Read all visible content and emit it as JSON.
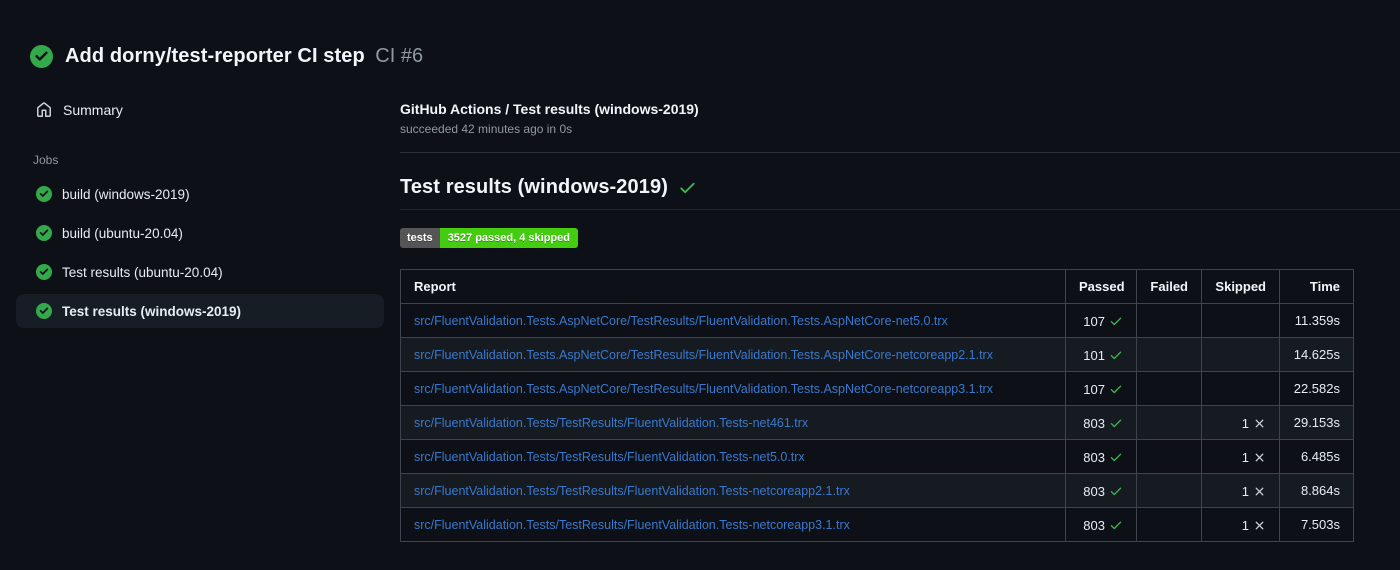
{
  "header": {
    "title": "Add dorny/test-reporter CI step",
    "run_number": "CI #6",
    "status": "success"
  },
  "sidebar": {
    "summary_label": "Summary",
    "jobs_section_label": "Jobs",
    "jobs": [
      {
        "label": "build (windows-2019)",
        "status": "success",
        "selected": false
      },
      {
        "label": "build (ubuntu-20.04)",
        "status": "success",
        "selected": false
      },
      {
        "label": "Test results (ubuntu-20.04)",
        "status": "success",
        "selected": false
      },
      {
        "label": "Test results (windows-2019)",
        "status": "success",
        "selected": true
      }
    ]
  },
  "main": {
    "check_header": {
      "title": "GitHub Actions / Test results (windows-2019)",
      "subtitle": "succeeded 42 minutes ago in 0s"
    },
    "section": {
      "title": "Test results (windows-2019)",
      "status": "success"
    },
    "badge": {
      "label": "tests",
      "value": "3527 passed, 4 skipped",
      "label_bg": "#555555",
      "value_bg": "#44cc11"
    },
    "table": {
      "headers": [
        "Report",
        "Passed",
        "Failed",
        "Skipped",
        "Time"
      ],
      "rows": [
        {
          "report": "src/FluentValidation.Tests.AspNetCore/TestResults/FluentValidation.Tests.AspNetCore-net5.0.trx",
          "passed": "107",
          "failed": "",
          "skipped": "",
          "time": "11.359s"
        },
        {
          "report": "src/FluentValidation.Tests.AspNetCore/TestResults/FluentValidation.Tests.AspNetCore-netcoreapp2.1.trx",
          "passed": "101",
          "failed": "",
          "skipped": "",
          "time": "14.625s"
        },
        {
          "report": "src/FluentValidation.Tests.AspNetCore/TestResults/FluentValidation.Tests.AspNetCore-netcoreapp3.1.trx",
          "passed": "107",
          "failed": "",
          "skipped": "",
          "time": "22.582s"
        },
        {
          "report": "src/FluentValidation.Tests/TestResults/FluentValidation.Tests-net461.trx",
          "passed": "803",
          "failed": "",
          "skipped": "1",
          "time": "29.153s"
        },
        {
          "report": "src/FluentValidation.Tests/TestResults/FluentValidation.Tests-net5.0.trx",
          "passed": "803",
          "failed": "",
          "skipped": "1",
          "time": "6.485s"
        },
        {
          "report": "src/FluentValidation.Tests/TestResults/FluentValidation.Tests-netcoreapp2.1.trx",
          "passed": "803",
          "failed": "",
          "skipped": "1",
          "time": "8.864s"
        },
        {
          "report": "src/FluentValidation.Tests/TestResults/FluentValidation.Tests-netcoreapp3.1.trx",
          "passed": "803",
          "failed": "",
          "skipped": "1",
          "time": "7.503s"
        }
      ]
    }
  },
  "colors": {
    "success_green": "#3fb950",
    "check_inner": "#0d1117",
    "passed_check": "#3fb950",
    "skipped_x": "#ccd2d9",
    "link_blue": "#3a78cc"
  }
}
